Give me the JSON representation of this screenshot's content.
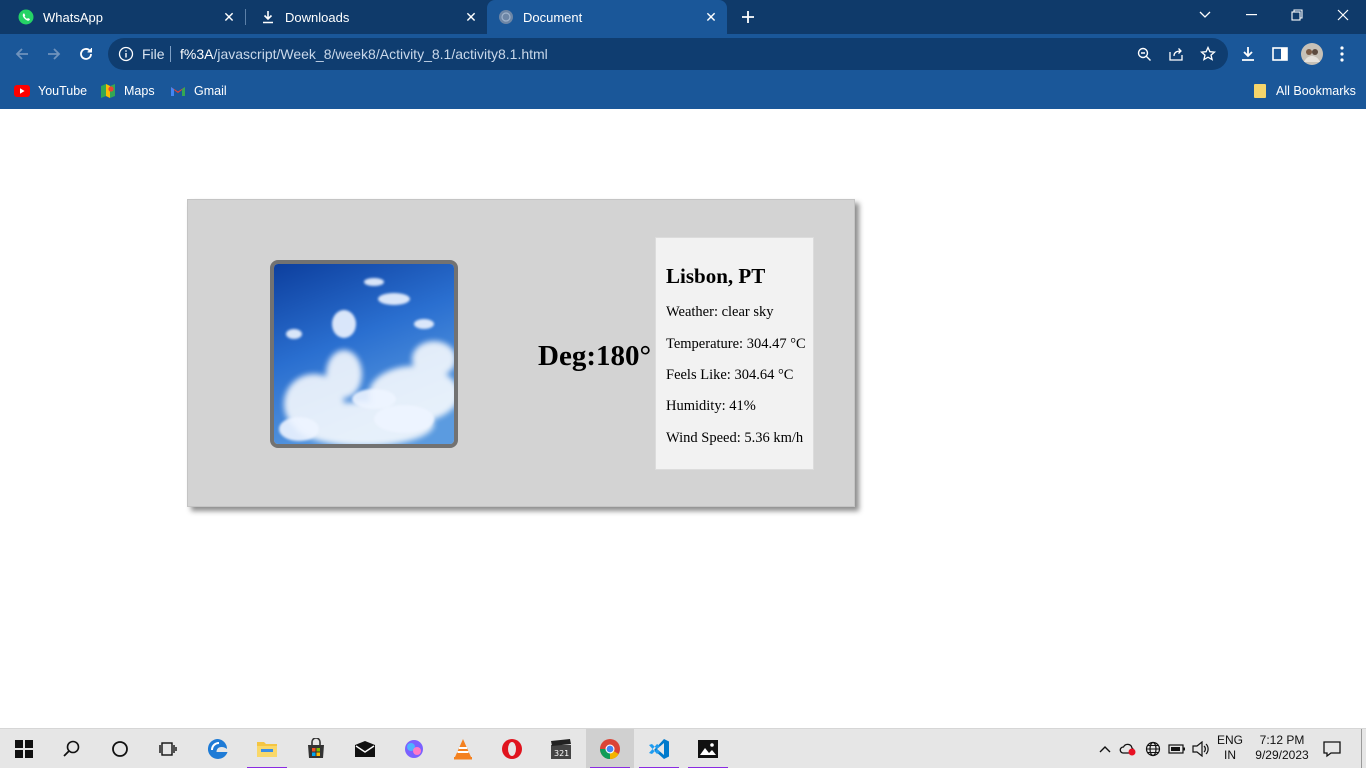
{
  "browser": {
    "tabs": [
      {
        "title": "WhatsApp",
        "icon": "whatsapp-icon",
        "active": false
      },
      {
        "title": "Downloads",
        "icon": "download-icon",
        "active": false
      },
      {
        "title": "Document",
        "icon": "globe-icon",
        "active": true
      }
    ],
    "address": {
      "scheme_label": "File",
      "url_bright": "f%3A",
      "url_dim": "/javascript/Week_8/week8/Activity_8.1/activity8.1.html"
    },
    "bookmarks": [
      {
        "label": "YouTube",
        "icon": "youtube-icon"
      },
      {
        "label": "Maps",
        "icon": "maps-icon"
      },
      {
        "label": "Gmail",
        "icon": "gmail-icon"
      }
    ],
    "all_bookmarks_label": "All Bookmarks",
    "colors": {
      "frame": "#0f3a6a",
      "toolbar": "#1a5799"
    }
  },
  "weather": {
    "deg_label": "Deg:180°",
    "city": "Lisbon, PT",
    "weather": "Weather: clear sky",
    "temperature": "Temperature: 304.47 °C",
    "feels_like": "Feels Like: 304.64 °C",
    "humidity": "Humidity: 41%",
    "wind_speed": "Wind Speed: 5.36 km/h",
    "image": "sky-with-clouds"
  },
  "taskbar": {
    "apps": [
      "start-icon",
      "search-icon",
      "cortana-icon",
      "task-view-icon",
      "edge-icon",
      "file-explorer-icon",
      "store-icon",
      "mail-icon",
      "copilot-icon",
      "vlc-icon",
      "opera-icon",
      "clapper-icon",
      "chrome-icon",
      "vscode-icon",
      "photos-icon"
    ],
    "lang_top": "ENG",
    "lang_bottom": "IN",
    "time": "7:12 PM",
    "date": "9/29/2023"
  }
}
